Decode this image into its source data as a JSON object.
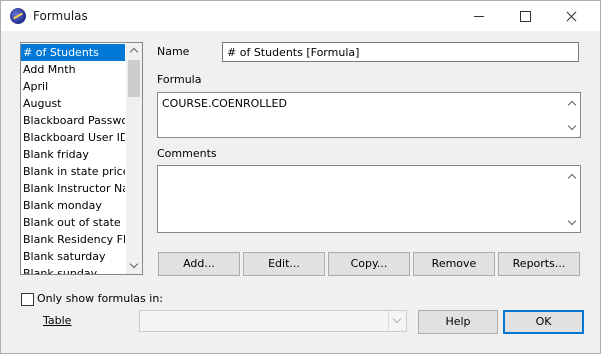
{
  "window": {
    "title": "Formulas"
  },
  "list": {
    "items": [
      "# of Students",
      "Add Mnth",
      "April",
      "August",
      "Blackboard Passwo",
      "Blackboard User ID",
      "Blank friday",
      "Blank in state price",
      "Blank Instructor Na",
      "Blank monday",
      "Blank out of state p",
      "Blank Residency Fla",
      "Blank saturday",
      "Blank sunday"
    ],
    "selected": "# of Students"
  },
  "form": {
    "name_label": "Name",
    "name_value": "# of Students [Formula]",
    "formula_label": "Formula",
    "formula_value": "COURSE.COENROLLED",
    "comments_label": "Comments",
    "comments_value": ""
  },
  "actions": {
    "add": "Add...",
    "edit": "Edit...",
    "copy": "Copy...",
    "remove": "Remove",
    "reports": "Reports..."
  },
  "filter": {
    "checkbox_label": "Only show formulas in:",
    "table_label": "Table",
    "table_value": ""
  },
  "footer": {
    "help": "Help",
    "ok": "OK"
  },
  "colors": {
    "selection": "#0078d7",
    "dialog_bg": "#f0f0f0"
  }
}
